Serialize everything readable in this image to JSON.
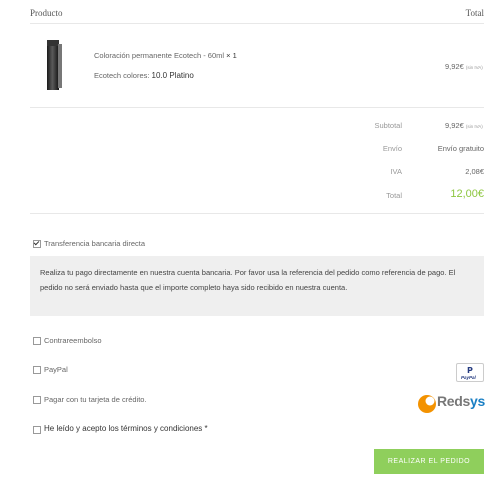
{
  "table": {
    "header_product": "Producto",
    "header_total": "Total"
  },
  "item": {
    "name": "Coloración permanente Ecotech - 60ml",
    "qty": "× 1",
    "variant_label": "Ecotech colores:",
    "variant_value": "10.0 Platino",
    "price": "9,92€",
    "price_note": "(sin IVA)"
  },
  "totals": {
    "subtotal_label": "Subtotal",
    "subtotal_value": "9,92€",
    "subtotal_note": "(sin IVA)",
    "shipping_label": "Envío",
    "shipping_value": "Envío gratuito",
    "tax_label": "IVA",
    "tax_value": "2,08€",
    "total_label": "Total",
    "total_value": "12,00€"
  },
  "payment": {
    "bank_label": "Transferencia bancaria directa",
    "bank_description": "Realiza tu pago directamente en nuestra cuenta bancaria. Por favor usa la referencia del pedido como referencia de pago. El pedido no será enviado hasta que el importe completo haya sido recibido en nuestra cuenta.",
    "cod_label": "Contrareembolso",
    "paypal_label": "PayPal",
    "paypal_logo_text": "PayPal",
    "card_label": "Pagar con tu tarjeta de crédito.",
    "redsys_logo_text_a": "Reds",
    "redsys_logo_text_b": "ys"
  },
  "terms": {
    "label": "He leído y acepto los términos y condiciones *"
  },
  "submit": {
    "label": "REALIZAR EL PEDIDO"
  },
  "colors": {
    "accent_green": "#8fcf5c",
    "total_green": "#8dc63f",
    "redsys_orange": "#f39200",
    "redsys_blue": "#1a7fc4"
  }
}
